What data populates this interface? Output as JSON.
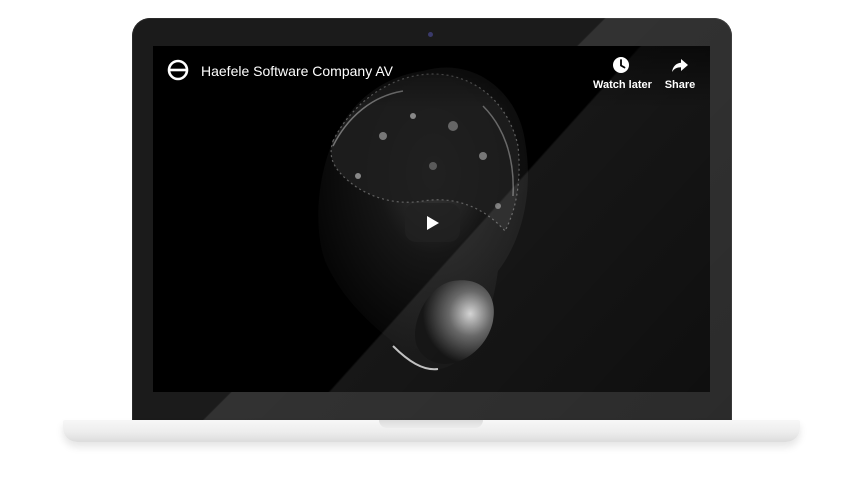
{
  "video": {
    "title": "Haefele Software Company AV",
    "channel_logo": "haefele-logo-icon"
  },
  "actions": {
    "watch_later": {
      "label": "Watch later",
      "icon": "clock-icon"
    },
    "share": {
      "label": "Share",
      "icon": "share-arrow-icon"
    }
  },
  "player": {
    "play_icon": "play-icon",
    "play_button_color": "#212121"
  },
  "colors": {
    "bezel": "#1b1b1b",
    "screen": "#000000",
    "base": "#ededed"
  }
}
